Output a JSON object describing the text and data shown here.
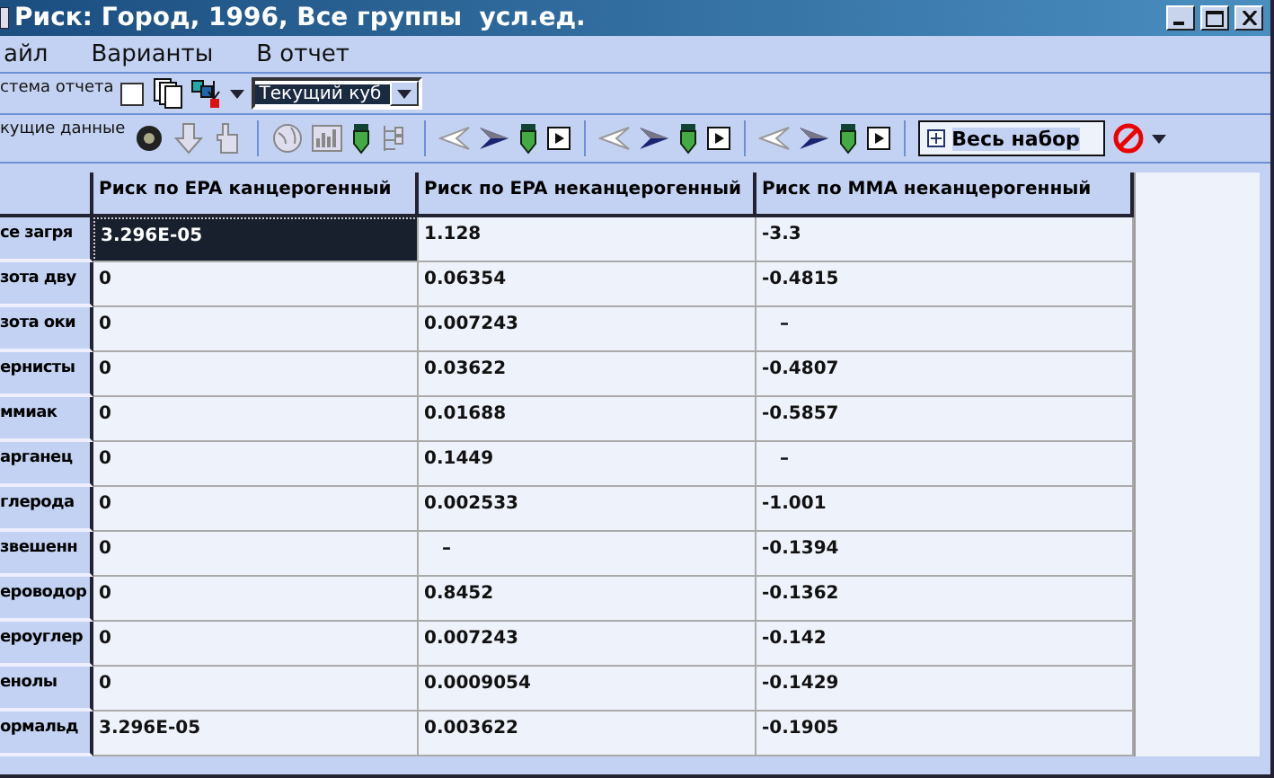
{
  "window": {
    "title": "Риск: Город, 1996, Все группы  усл.ед."
  },
  "menu": [
    {
      "label": "айл"
    },
    {
      "label": "Варианты"
    },
    {
      "label": "В отчет"
    }
  ],
  "toolbar_report": {
    "label": "стема отчета",
    "checkbox_checked": false,
    "combo_value": "Текущий куб"
  },
  "toolbar_data": {
    "label": "кущие данные",
    "set_field": "Весь набор"
  },
  "table": {
    "columns": [
      "Риск по EPA канцерогенный",
      "Риск по EPA неканцерогенный",
      "Риск по MMA неканцерогенный"
    ],
    "rows": [
      {
        "label": "се загря",
        "cells": [
          {
            "text": "3.296E-05",
            "selected": true
          },
          {
            "text": "1.128",
            "selected": false
          },
          {
            "text": "-3.3",
            "selected": false
          }
        ]
      },
      {
        "label": "зота дву",
        "cells": [
          {
            "text": "0",
            "selected": false
          },
          {
            "text": "0.06354",
            "selected": false
          },
          {
            "text": "-0.4815",
            "selected": false
          }
        ]
      },
      {
        "label": "зота оки",
        "cells": [
          {
            "text": "0",
            "selected": false
          },
          {
            "text": "0.007243",
            "selected": false
          },
          {
            "text": "–",
            "selected": false
          }
        ]
      },
      {
        "label": "ернисты",
        "cells": [
          {
            "text": "0",
            "selected": false
          },
          {
            "text": "0.03622",
            "selected": false
          },
          {
            "text": "-0.4807",
            "selected": false
          }
        ]
      },
      {
        "label": "ммиак",
        "cells": [
          {
            "text": "0",
            "selected": false
          },
          {
            "text": "0.01688",
            "selected": false
          },
          {
            "text": "-0.5857",
            "selected": false
          }
        ]
      },
      {
        "label": "арганец",
        "cells": [
          {
            "text": "0",
            "selected": false
          },
          {
            "text": "0.1449",
            "selected": false
          },
          {
            "text": "–",
            "selected": false
          }
        ]
      },
      {
        "label": "глерода",
        "cells": [
          {
            "text": "0",
            "selected": false
          },
          {
            "text": "0.002533",
            "selected": false
          },
          {
            "text": "-1.001",
            "selected": false
          }
        ]
      },
      {
        "label": "звешенн",
        "cells": [
          {
            "text": "0",
            "selected": false
          },
          {
            "text": "–",
            "selected": false
          },
          {
            "text": "-0.1394",
            "selected": false
          }
        ]
      },
      {
        "label": "ероводор",
        "cells": [
          {
            "text": "0",
            "selected": false
          },
          {
            "text": "0.8452",
            "selected": false
          },
          {
            "text": "-0.1362",
            "selected": false
          }
        ]
      },
      {
        "label": "ероуглер",
        "cells": [
          {
            "text": "0",
            "selected": false
          },
          {
            "text": "0.007243",
            "selected": false
          },
          {
            "text": "-0.142",
            "selected": false
          }
        ]
      },
      {
        "label": "енолы",
        "cells": [
          {
            "text": "0",
            "selected": false
          },
          {
            "text": "0.0009054",
            "selected": false
          },
          {
            "text": "-0.1429",
            "selected": false
          }
        ]
      },
      {
        "label": "ормальд",
        "cells": [
          {
            "text": "3.296E-05",
            "selected": false
          },
          {
            "text": "0.003622",
            "selected": false
          },
          {
            "text": "-0.1905",
            "selected": false
          }
        ]
      }
    ]
  }
}
